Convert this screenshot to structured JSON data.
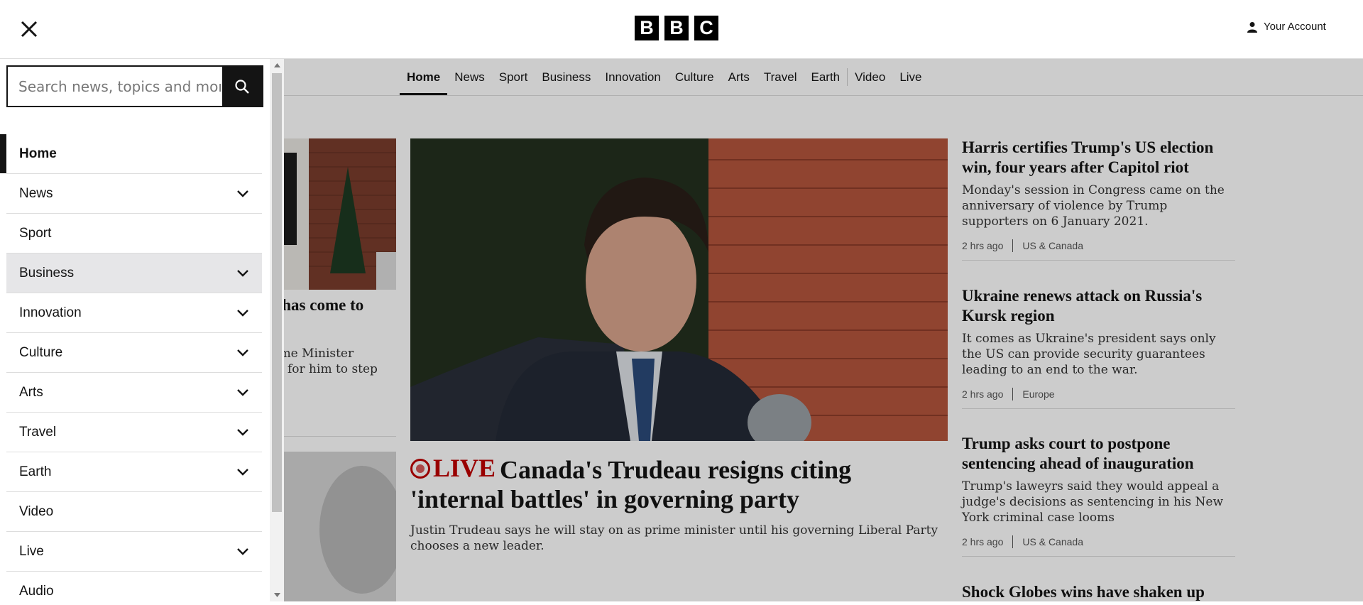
{
  "header": {
    "logo_letters": [
      "B",
      "B",
      "C"
    ],
    "account_label": "Your Account"
  },
  "search": {
    "placeholder": "Search news, topics and more"
  },
  "menu": [
    {
      "label": "Home",
      "expandable": false,
      "active": true
    },
    {
      "label": "News",
      "expandable": true
    },
    {
      "label": "Sport",
      "expandable": false
    },
    {
      "label": "Business",
      "expandable": true,
      "hovered": true
    },
    {
      "label": "Innovation",
      "expandable": true
    },
    {
      "label": "Culture",
      "expandable": true
    },
    {
      "label": "Arts",
      "expandable": true
    },
    {
      "label": "Travel",
      "expandable": true
    },
    {
      "label": "Earth",
      "expandable": true
    },
    {
      "label": "Video",
      "expandable": false
    },
    {
      "label": "Live",
      "expandable": true
    },
    {
      "label": "Audio",
      "expandable": false
    }
  ],
  "topnav": [
    "Home",
    "News",
    "Sport",
    "Business",
    "Innovation",
    "Culture",
    "Arts",
    "Travel",
    "Earth",
    "Video",
    "Live"
  ],
  "left_card": {
    "title": "a has come to",
    "desc": "rime Minister\nlls for him to step"
  },
  "hero": {
    "live_label": "LIVE",
    "title": "Canada's Trudeau resigns citing 'internal battles' in governing party",
    "desc": "Justin Trudeau says he will stay on as prime minister until his governing Liberal Party chooses a new leader."
  },
  "stories": [
    {
      "title": "Harris certifies Trump's US election win, four years after Capitol riot",
      "desc": "Monday's session in Congress came on the anniversary of violence by Trump supporters on 6 January 2021.",
      "time": "2 hrs ago",
      "section": "US & Canada"
    },
    {
      "title": "Ukraine renews attack on Russia's Kursk region",
      "desc": "It comes as Ukraine's president says only the US can provide security guarantees leading to an end to the war.",
      "time": "2 hrs ago",
      "section": "Europe"
    },
    {
      "title": "Trump asks court to postpone sentencing ahead of inauguration",
      "desc": "Trump's laweyrs said they would appeal a judge's decisions as sentencing in his New York criminal case looms",
      "time": "2 hrs ago",
      "section": "US & Canada"
    },
    {
      "title": "Shock Globes wins have shaken up"
    }
  ],
  "colors": {
    "live_red": "#c00000",
    "ink": "#141414",
    "hover_bg": "#e6e6e8"
  }
}
